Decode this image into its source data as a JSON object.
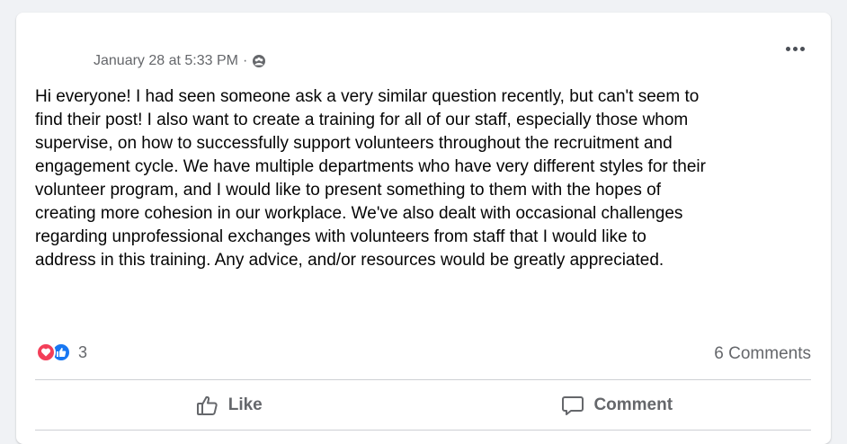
{
  "post": {
    "timestamp": "January 28 at 5:33 PM",
    "separator": "·",
    "audience_icon": "group-icon",
    "more_icon": "more-options-icon",
    "body": "Hi everyone! I had seen someone ask a very similar question recently, but can't seem to\nfind their post! I also want to create a training for all of our staff, especially those whom\nsupervise, on how to successfully support volunteers throughout the recruitment and\nengagement cycle. We have multiple departments who have very different styles for their\nvolunteer program, and I would like to present something to them with the hopes of\ncreating more cohesion in our workplace. We've also dealt with occasional challenges\nregarding unprofessional exchanges with volunteers from staff that I would like to\naddress in this training. Any advice, and/or resources would be greatly appreciated."
  },
  "reactions": {
    "count": "3",
    "types": [
      "love",
      "like"
    ],
    "colors": {
      "love": "#f33e58",
      "like": "#1877f2"
    }
  },
  "comments": {
    "count_label": "6 Comments"
  },
  "actions": {
    "like_label": "Like",
    "comment_label": "Comment"
  }
}
